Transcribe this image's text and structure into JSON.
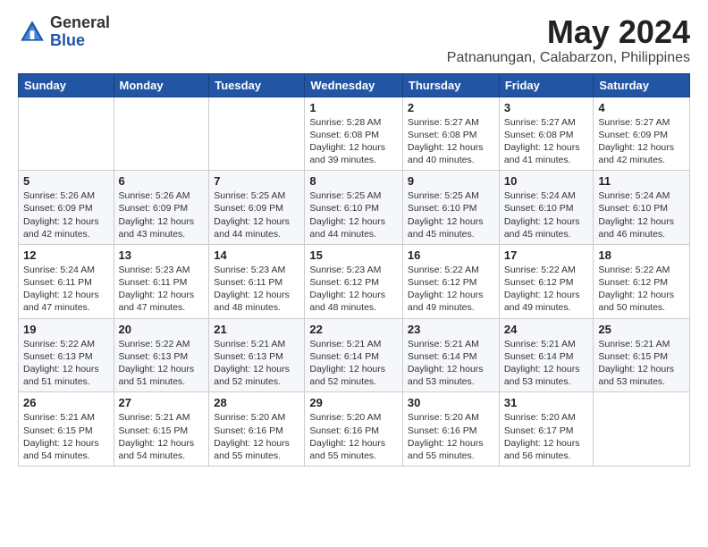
{
  "logo": {
    "general": "General",
    "blue": "Blue"
  },
  "title": {
    "month": "May 2024",
    "location": "Patnanungan, Calabarzon, Philippines"
  },
  "headers": [
    "Sunday",
    "Monday",
    "Tuesday",
    "Wednesday",
    "Thursday",
    "Friday",
    "Saturday"
  ],
  "weeks": [
    [
      {
        "day": "",
        "info": ""
      },
      {
        "day": "",
        "info": ""
      },
      {
        "day": "",
        "info": ""
      },
      {
        "day": "1",
        "info": "Sunrise: 5:28 AM\nSunset: 6:08 PM\nDaylight: 12 hours\nand 39 minutes."
      },
      {
        "day": "2",
        "info": "Sunrise: 5:27 AM\nSunset: 6:08 PM\nDaylight: 12 hours\nand 40 minutes."
      },
      {
        "day": "3",
        "info": "Sunrise: 5:27 AM\nSunset: 6:08 PM\nDaylight: 12 hours\nand 41 minutes."
      },
      {
        "day": "4",
        "info": "Sunrise: 5:27 AM\nSunset: 6:09 PM\nDaylight: 12 hours\nand 42 minutes."
      }
    ],
    [
      {
        "day": "5",
        "info": "Sunrise: 5:26 AM\nSunset: 6:09 PM\nDaylight: 12 hours\nand 42 minutes."
      },
      {
        "day": "6",
        "info": "Sunrise: 5:26 AM\nSunset: 6:09 PM\nDaylight: 12 hours\nand 43 minutes."
      },
      {
        "day": "7",
        "info": "Sunrise: 5:25 AM\nSunset: 6:09 PM\nDaylight: 12 hours\nand 44 minutes."
      },
      {
        "day": "8",
        "info": "Sunrise: 5:25 AM\nSunset: 6:10 PM\nDaylight: 12 hours\nand 44 minutes."
      },
      {
        "day": "9",
        "info": "Sunrise: 5:25 AM\nSunset: 6:10 PM\nDaylight: 12 hours\nand 45 minutes."
      },
      {
        "day": "10",
        "info": "Sunrise: 5:24 AM\nSunset: 6:10 PM\nDaylight: 12 hours\nand 45 minutes."
      },
      {
        "day": "11",
        "info": "Sunrise: 5:24 AM\nSunset: 6:10 PM\nDaylight: 12 hours\nand 46 minutes."
      }
    ],
    [
      {
        "day": "12",
        "info": "Sunrise: 5:24 AM\nSunset: 6:11 PM\nDaylight: 12 hours\nand 47 minutes."
      },
      {
        "day": "13",
        "info": "Sunrise: 5:23 AM\nSunset: 6:11 PM\nDaylight: 12 hours\nand 47 minutes."
      },
      {
        "day": "14",
        "info": "Sunrise: 5:23 AM\nSunset: 6:11 PM\nDaylight: 12 hours\nand 48 minutes."
      },
      {
        "day": "15",
        "info": "Sunrise: 5:23 AM\nSunset: 6:12 PM\nDaylight: 12 hours\nand 48 minutes."
      },
      {
        "day": "16",
        "info": "Sunrise: 5:22 AM\nSunset: 6:12 PM\nDaylight: 12 hours\nand 49 minutes."
      },
      {
        "day": "17",
        "info": "Sunrise: 5:22 AM\nSunset: 6:12 PM\nDaylight: 12 hours\nand 49 minutes."
      },
      {
        "day": "18",
        "info": "Sunrise: 5:22 AM\nSunset: 6:12 PM\nDaylight: 12 hours\nand 50 minutes."
      }
    ],
    [
      {
        "day": "19",
        "info": "Sunrise: 5:22 AM\nSunset: 6:13 PM\nDaylight: 12 hours\nand 51 minutes."
      },
      {
        "day": "20",
        "info": "Sunrise: 5:22 AM\nSunset: 6:13 PM\nDaylight: 12 hours\nand 51 minutes."
      },
      {
        "day": "21",
        "info": "Sunrise: 5:21 AM\nSunset: 6:13 PM\nDaylight: 12 hours\nand 52 minutes."
      },
      {
        "day": "22",
        "info": "Sunrise: 5:21 AM\nSunset: 6:14 PM\nDaylight: 12 hours\nand 52 minutes."
      },
      {
        "day": "23",
        "info": "Sunrise: 5:21 AM\nSunset: 6:14 PM\nDaylight: 12 hours\nand 53 minutes."
      },
      {
        "day": "24",
        "info": "Sunrise: 5:21 AM\nSunset: 6:14 PM\nDaylight: 12 hours\nand 53 minutes."
      },
      {
        "day": "25",
        "info": "Sunrise: 5:21 AM\nSunset: 6:15 PM\nDaylight: 12 hours\nand 53 minutes."
      }
    ],
    [
      {
        "day": "26",
        "info": "Sunrise: 5:21 AM\nSunset: 6:15 PM\nDaylight: 12 hours\nand 54 minutes."
      },
      {
        "day": "27",
        "info": "Sunrise: 5:21 AM\nSunset: 6:15 PM\nDaylight: 12 hours\nand 54 minutes."
      },
      {
        "day": "28",
        "info": "Sunrise: 5:20 AM\nSunset: 6:16 PM\nDaylight: 12 hours\nand 55 minutes."
      },
      {
        "day": "29",
        "info": "Sunrise: 5:20 AM\nSunset: 6:16 PM\nDaylight: 12 hours\nand 55 minutes."
      },
      {
        "day": "30",
        "info": "Sunrise: 5:20 AM\nSunset: 6:16 PM\nDaylight: 12 hours\nand 55 minutes."
      },
      {
        "day": "31",
        "info": "Sunrise: 5:20 AM\nSunset: 6:17 PM\nDaylight: 12 hours\nand 56 minutes."
      },
      {
        "day": "",
        "info": ""
      }
    ]
  ]
}
